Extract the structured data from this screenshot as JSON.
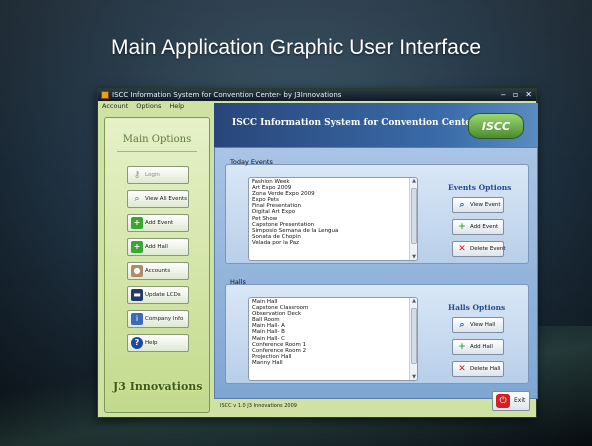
{
  "slide": {
    "title": "Main Application Graphic User Interface"
  },
  "window": {
    "title": "ISCC Information System for Convention Center- by J3Innovations",
    "controls": [
      "‒",
      "▫",
      "✕"
    ]
  },
  "menu": {
    "items": [
      "Account",
      "Options",
      "Help"
    ]
  },
  "sidebar": {
    "title": "Main Options",
    "buttons": [
      {
        "label": "Login",
        "icon": "key-icon"
      },
      {
        "label": "View All Events",
        "icon": "magnifier-icon"
      },
      {
        "label": "Add Event",
        "icon": "plus-icon"
      },
      {
        "label": "Add Hall",
        "icon": "plus-icon"
      },
      {
        "label": "Accounts",
        "icon": "user-icon"
      },
      {
        "label": "Update LCDs",
        "icon": "monitor-icon"
      },
      {
        "label": "Company Info",
        "icon": "info-icon"
      },
      {
        "label": "Help",
        "icon": "question-icon"
      }
    ],
    "logo": "J3 Innovations"
  },
  "header": {
    "title": "ISCC Information System for Convention Center",
    "logo": "ISCC"
  },
  "events": {
    "group_label": "Today Events",
    "items": [
      "Fashion Week",
      "Art Expo 2009",
      "Zona Verde Expo 2009",
      "Expo Pets",
      "Final Presentation",
      "Digital Art Expo",
      "Pet Show",
      "Capstone Presentation",
      "Simposio Semana de la Lengua",
      "Sonata de Chopin",
      "Velada por la Paz"
    ],
    "options_title": "Events Options",
    "buttons": [
      "View Event",
      "Add Event",
      "Delete Event"
    ]
  },
  "halls": {
    "group_label": "Halls",
    "items": [
      "Main Hall",
      "Capstone Classroom",
      "Observation Deck",
      "Ball Room",
      "Main Hall- A",
      "Main Hall- B",
      "Main Hall- C",
      "Conference Room 1",
      "Conference Room 2",
      "Projection Hall",
      "Manny Hall"
    ],
    "options_title": "Halls Options",
    "buttons": [
      "View Hall",
      "Add Hall",
      "Delete Hall"
    ]
  },
  "status": {
    "text": "ISCC v 1.0 J3 Innovations 2009"
  },
  "exit_label": "Exit"
}
